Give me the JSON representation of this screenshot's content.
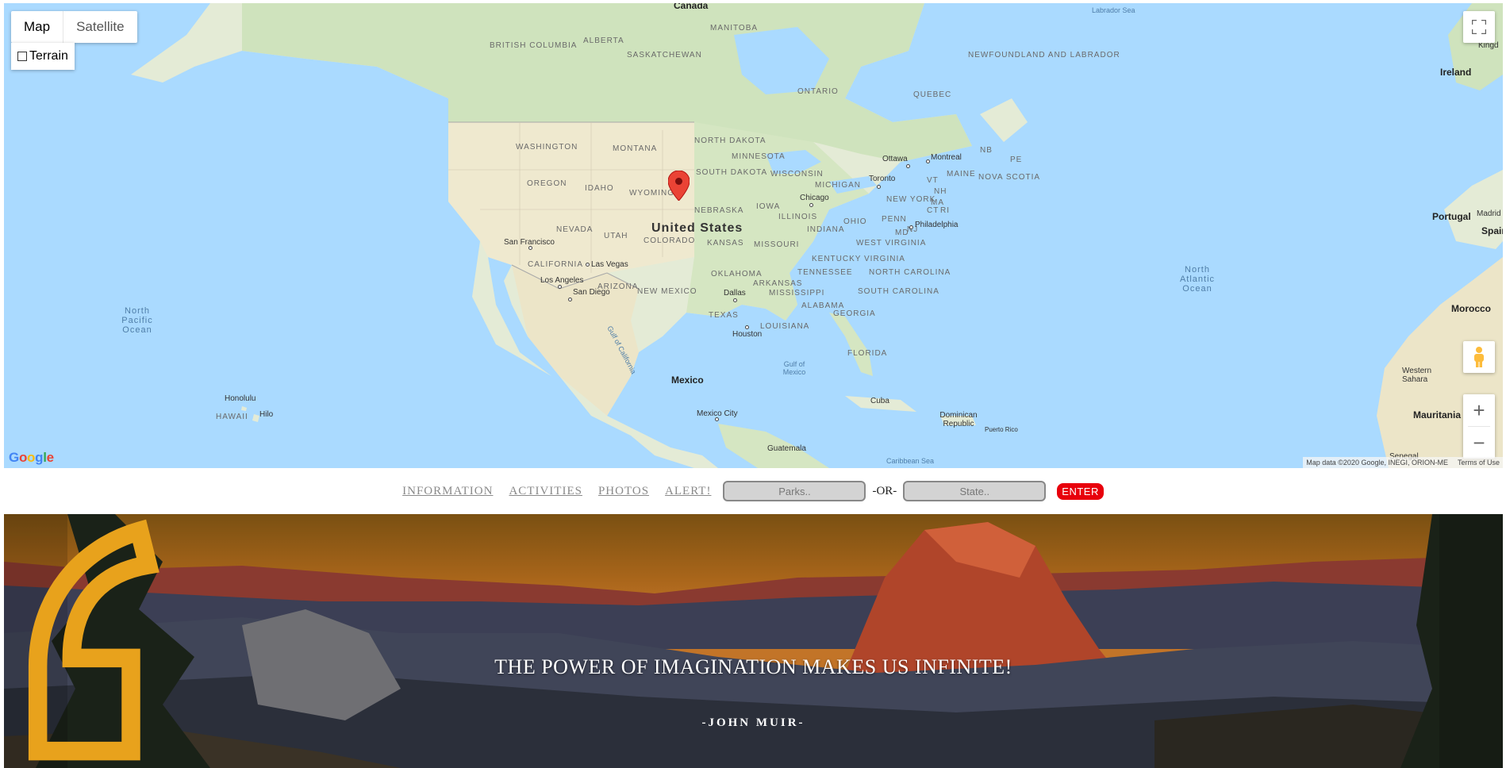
{
  "map": {
    "type_control": {
      "map_label": "Map",
      "satellite_label": "Satellite",
      "terrain_label": "Terrain"
    },
    "labels": {
      "countries": [
        "Canada",
        "United States",
        "Mexico",
        "Cuba",
        "Dominican Republic",
        "Guatemala",
        "Ireland",
        "Portugal",
        "Morocco",
        "Western Sahara",
        "Mauritania",
        "Senegal"
      ],
      "states": [
        "BRITISH COLUMBIA",
        "ALBERTA",
        "SASKATCHEWAN",
        "MANITOBA",
        "ONTARIO",
        "QUEBEC",
        "NEWFOUNDLAND AND LABRADOR",
        "WASHINGTON",
        "MONTANA",
        "NORTH DAKOTA",
        "MINNESOTA",
        "OREGON",
        "IDAHO",
        "SOUTH DAKOTA",
        "WYOMING",
        "WISCONSIN",
        "MICHIGAN",
        "NEBRASKA",
        "IOWA",
        "NEVADA",
        "UTAH",
        "COLORADO",
        "KANSAS",
        "MISSOURI",
        "ILLINOIS",
        "INDIANA",
        "OHIO",
        "PENN",
        "CALIFORNIA",
        "ARIZONA",
        "NEW MEXICO",
        "OKLAHOMA",
        "ARKANSAS",
        "TENNESSEE",
        "KENTUCKY",
        "VIRGINIA",
        "WEST VIRGINIA",
        "NORTH CAROLINA",
        "SOUTH CAROLINA",
        "TEXAS",
        "LOUISIANA",
        "MISSISSIPPI",
        "ALABAMA",
        "GEORGIA",
        "FLORIDA",
        "NEW YORK",
        "MAINE",
        "NOVA SCOTIA",
        "NB",
        "PE",
        "VT",
        "NH",
        "MA",
        "CT",
        "RI",
        "MD",
        "NJ",
        "HAWAII"
      ],
      "cities": [
        "Ottawa",
        "Montreal",
        "Toronto",
        "Chicago",
        "Philadelphia",
        "San Francisco",
        "Las Vegas",
        "Los Angeles",
        "San Diego",
        "Dallas",
        "Houston",
        "Mexico City",
        "Honolulu",
        "Hilo",
        "Puerto Rico",
        "Kingd",
        "Madrid",
        "Spain"
      ],
      "water": [
        "Labrador Sea",
        "North Pacific Ocean",
        "North Atlantic Ocean",
        "Gulf of Mexico",
        "Gulf of California",
        "Caribbean Sea"
      ]
    },
    "attribution": {
      "data": "Map data ©2020 Google, INEGI, ORION-ME",
      "terms": "Terms of Use"
    },
    "logo": "Google",
    "zoom_in": "+",
    "zoom_out": "−"
  },
  "nav": {
    "links": [
      "INFORMATION",
      "ACTIVITIES",
      "PHOTOS",
      "ALERT!"
    ],
    "parks_placeholder": "Parks..",
    "or_text": "-OR-",
    "state_placeholder": "State..",
    "enter_label": "ENTER"
  },
  "hero": {
    "quote": "THE POWER OF IMAGINATION MAKES US INFINITE!",
    "author": "-JOHN MUIR-",
    "accent_color": "#e8a21c"
  }
}
